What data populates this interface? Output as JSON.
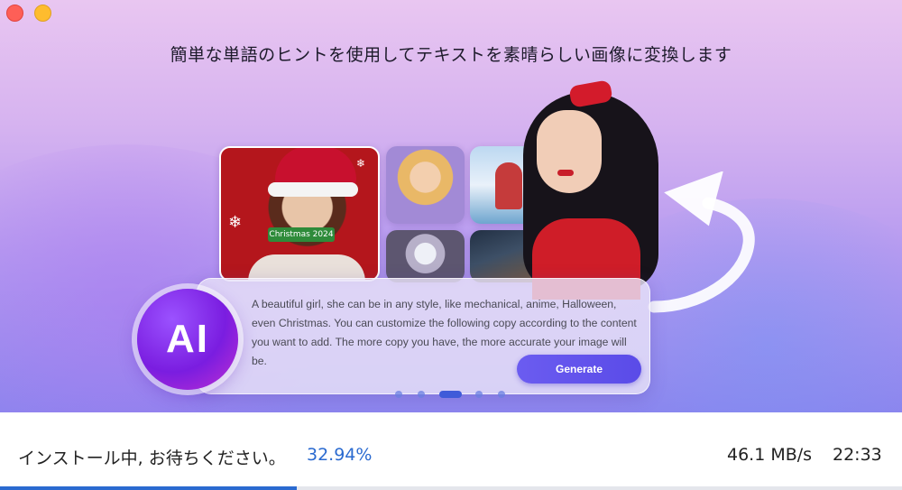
{
  "window": {
    "controls": [
      "close",
      "minimize"
    ]
  },
  "hero": {
    "headline": "簡単な単語のヒントを使用してテキストを素晴らしい画像に変換します",
    "sample_images": [
      "christmas-girl",
      "anime-girl-blonde",
      "anime-girl-sky",
      "mechanical-girl",
      "halloween-witch"
    ],
    "featured_image": "woman-red-bow",
    "tag_text": "Christmas 2024"
  },
  "prompt_panel": {
    "badge": "AI",
    "text": "A beautiful girl, she can be in any style, like mechanical, anime, Halloween, even Christmas. You can customize the following copy according to the content you want to add. The more copy you have, the more accurate your image will be.",
    "generate_label": "Generate"
  },
  "pager": {
    "count": 5,
    "active_index": 2
  },
  "status": {
    "label": "インストール中, お待ちください。",
    "percent_text": "32.94%",
    "progress": 0.3294,
    "speed": "46.1 MB/s",
    "time": "22:33"
  },
  "colors": {
    "accent": "#2a6ad0",
    "button": "#5a4be8"
  }
}
